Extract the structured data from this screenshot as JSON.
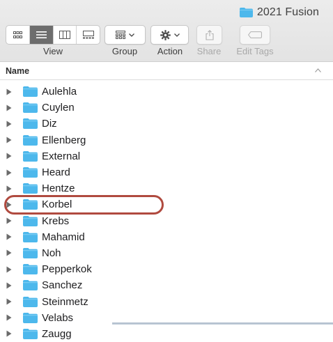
{
  "window": {
    "title": "2021 Fusion"
  },
  "toolbar": {
    "view_label": "View",
    "group_label": "Group",
    "action_label": "Action",
    "share_label": "Share",
    "edit_tags_label": "Edit Tags"
  },
  "column_header": {
    "name": "Name"
  },
  "folders": [
    {
      "name": "Aulehla"
    },
    {
      "name": "Cuylen"
    },
    {
      "name": "Diz"
    },
    {
      "name": "Ellenberg"
    },
    {
      "name": "External"
    },
    {
      "name": "Heard"
    },
    {
      "name": "Hentze"
    },
    {
      "name": "Korbel"
    },
    {
      "name": "Krebs"
    },
    {
      "name": "Mahamid"
    },
    {
      "name": "Noh"
    },
    {
      "name": "Pepperkok"
    },
    {
      "name": "Sanchez"
    },
    {
      "name": "Steinmetz"
    },
    {
      "name": "Velabs"
    },
    {
      "name": "Zaugg"
    }
  ],
  "highlighted_folder": "Korbel",
  "colors": {
    "folder": "#4db8ec",
    "highlight_ring": "#b04a3f",
    "selected_segment": "#6d6d6d"
  }
}
